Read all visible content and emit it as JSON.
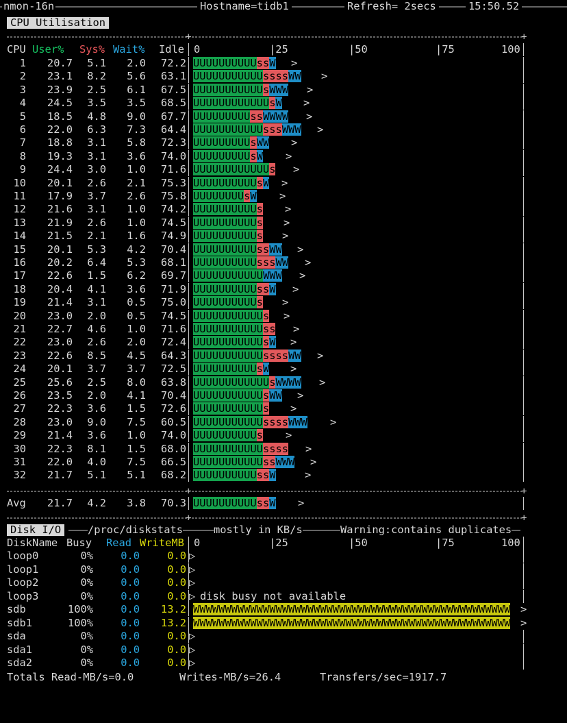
{
  "topbar": {
    "app": "nmon-16n",
    "host": "Hostname=tidb1",
    "refresh": "Refresh= 2secs",
    "time": "15:50.52"
  },
  "cpu": {
    "title": "CPU Utilisation",
    "headers": {
      "cpu": "CPU",
      "user": "User%",
      "sys": "Sys%",
      "wait": "Wait%",
      "idle": "Idle",
      "s0": "0",
      "s25": "|25",
      "s50": "|50",
      "s75": "|75",
      "s100": "100"
    },
    "rows": [
      {
        "cpu": "1",
        "user": "20.7",
        "sys": "5.1",
        "wait": "2.0",
        "idle": "72.2",
        "u": "UUUUUUUUUU",
        "s": "ss",
        "w": "W"
      },
      {
        "cpu": "2",
        "user": "23.1",
        "sys": "8.2",
        "wait": "5.6",
        "idle": "63.1",
        "u": "UUUUUUUUUUU",
        "s": "ssss",
        "w": "WW"
      },
      {
        "cpu": "3",
        "user": "23.9",
        "sys": "2.5",
        "wait": "6.1",
        "idle": "67.5",
        "u": "UUUUUUUUUUU",
        "s": "s",
        "w": "WWW"
      },
      {
        "cpu": "4",
        "user": "24.5",
        "sys": "3.5",
        "wait": "3.5",
        "idle": "68.5",
        "u": "UUUUUUUUUUUU",
        "s": "s",
        "w": "W"
      },
      {
        "cpu": "5",
        "user": "18.5",
        "sys": "4.8",
        "wait": "9.0",
        "idle": "67.7",
        "u": "UUUUUUUUU",
        "s": "ss",
        "w": "WWWW"
      },
      {
        "cpu": "6",
        "user": "22.0",
        "sys": "6.3",
        "wait": "7.3",
        "idle": "64.4",
        "u": "UUUUUUUUUUU",
        "s": "sss",
        "w": "WWW"
      },
      {
        "cpu": "7",
        "user": "18.8",
        "sys": "3.1",
        "wait": "5.8",
        "idle": "72.3",
        "u": "UUUUUUUUU",
        "s": "s",
        "w": "WW"
      },
      {
        "cpu": "8",
        "user": "19.3",
        "sys": "3.1",
        "wait": "3.6",
        "idle": "74.0",
        "u": "UUUUUUUUU",
        "s": "s",
        "w": "W"
      },
      {
        "cpu": "9",
        "user": "24.4",
        "sys": "3.0",
        "wait": "1.0",
        "idle": "71.6",
        "u": "UUUUUUUUUUUU",
        "s": "s",
        "w": ""
      },
      {
        "cpu": "10",
        "user": "20.1",
        "sys": "2.6",
        "wait": "2.1",
        "idle": "75.3",
        "u": "UUUUUUUUUU",
        "s": "s",
        "w": "W"
      },
      {
        "cpu": "11",
        "user": "17.9",
        "sys": "3.7",
        "wait": "2.6",
        "idle": "75.8",
        "u": "UUUUUUUU",
        "s": "s",
        "w": "W"
      },
      {
        "cpu": "12",
        "user": "21.6",
        "sys": "3.1",
        "wait": "1.0",
        "idle": "74.2",
        "u": "UUUUUUUUUU",
        "s": "s",
        "w": ""
      },
      {
        "cpu": "13",
        "user": "21.9",
        "sys": "2.6",
        "wait": "1.0",
        "idle": "74.5",
        "u": "UUUUUUUUUU",
        "s": "s",
        "w": ""
      },
      {
        "cpu": "14",
        "user": "21.5",
        "sys": "2.1",
        "wait": "1.6",
        "idle": "74.9",
        "u": "UUUUUUUUUU",
        "s": "s",
        "w": ""
      },
      {
        "cpu": "15",
        "user": "20.1",
        "sys": "5.3",
        "wait": "4.2",
        "idle": "70.4",
        "u": "UUUUUUUUUU",
        "s": "ss",
        "w": "WW"
      },
      {
        "cpu": "16",
        "user": "20.2",
        "sys": "6.4",
        "wait": "5.3",
        "idle": "68.1",
        "u": "UUUUUUUUUU",
        "s": "sss",
        "w": "WW"
      },
      {
        "cpu": "17",
        "user": "22.6",
        "sys": "1.5",
        "wait": "6.2",
        "idle": "69.7",
        "u": "UUUUUUUUUUU",
        "s": "",
        "w": "WWW"
      },
      {
        "cpu": "18",
        "user": "20.4",
        "sys": "4.1",
        "wait": "3.6",
        "idle": "71.9",
        "u": "UUUUUUUUUU",
        "s": "ss",
        "w": "W"
      },
      {
        "cpu": "19",
        "user": "21.4",
        "sys": "3.1",
        "wait": "0.5",
        "idle": "75.0",
        "u": "UUUUUUUUUU",
        "s": "s",
        "w": ""
      },
      {
        "cpu": "20",
        "user": "23.0",
        "sys": "2.0",
        "wait": "0.5",
        "idle": "74.5",
        "u": "UUUUUUUUUUU",
        "s": "s",
        "w": ""
      },
      {
        "cpu": "21",
        "user": "22.7",
        "sys": "4.6",
        "wait": "1.0",
        "idle": "71.6",
        "u": "UUUUUUUUUUU",
        "s": "ss",
        "w": ""
      },
      {
        "cpu": "22",
        "user": "23.0",
        "sys": "2.6",
        "wait": "2.0",
        "idle": "72.4",
        "u": "UUUUUUUUUUU",
        "s": "s",
        "w": "W"
      },
      {
        "cpu": "23",
        "user": "22.6",
        "sys": "8.5",
        "wait": "4.5",
        "idle": "64.3",
        "u": "UUUUUUUUUUU",
        "s": "ssss",
        "w": "WW"
      },
      {
        "cpu": "24",
        "user": "20.1",
        "sys": "3.7",
        "wait": "3.7",
        "idle": "72.5",
        "u": "UUUUUUUUUU",
        "s": "s",
        "w": "W"
      },
      {
        "cpu": "25",
        "user": "25.6",
        "sys": "2.5",
        "wait": "8.0",
        "idle": "63.8",
        "u": "UUUUUUUUUUUU",
        "s": "s",
        "w": "WWWW"
      },
      {
        "cpu": "26",
        "user": "23.5",
        "sys": "2.0",
        "wait": "4.1",
        "idle": "70.4",
        "u": "UUUUUUUUUUU",
        "s": "s",
        "w": "WW"
      },
      {
        "cpu": "27",
        "user": "22.3",
        "sys": "3.6",
        "wait": "1.5",
        "idle": "72.6",
        "u": "UUUUUUUUUUU",
        "s": "s",
        "w": ""
      },
      {
        "cpu": "28",
        "user": "23.0",
        "sys": "9.0",
        "wait": "7.5",
        "idle": "60.5",
        "u": "UUUUUUUUUUU",
        "s": "ssss",
        "w": "WWW"
      },
      {
        "cpu": "29",
        "user": "21.4",
        "sys": "3.6",
        "wait": "1.0",
        "idle": "74.0",
        "u": "UUUUUUUUUU",
        "s": "s",
        "w": ""
      },
      {
        "cpu": "30",
        "user": "22.3",
        "sys": "8.1",
        "wait": "1.5",
        "idle": "68.0",
        "u": "UUUUUUUUUUU",
        "s": "ssss",
        "w": ""
      },
      {
        "cpu": "31",
        "user": "22.0",
        "sys": "4.0",
        "wait": "7.5",
        "idle": "66.5",
        "u": "UUUUUUUUUUU",
        "s": "ss",
        "w": "WWW"
      },
      {
        "cpu": "32",
        "user": "21.7",
        "sys": "5.1",
        "wait": "5.1",
        "idle": "68.2",
        "u": "UUUUUUUUUU",
        "s": "ss",
        "w": "W"
      }
    ],
    "avg": {
      "label": "Avg",
      "user": "21.7",
      "sys": "4.2",
      "wait": "3.8",
      "idle": "70.3",
      "u": "UUUUUUUUUU",
      "s": "ss",
      "w": "W"
    }
  },
  "disk": {
    "title": "Disk I/O",
    "source": "/proc/diskstats",
    "units": "mostly in KB/s",
    "warning": "Warning:contains duplicates",
    "headers": {
      "name": "DiskName",
      "busy": "Busy",
      "read": "Read",
      "write": "WriteMB",
      "s0": "0",
      "s25": "|25",
      "s50": "|50",
      "s75": "|75",
      "s100": "100"
    },
    "rows": [
      {
        "name": "loop0",
        "busy": "0%",
        "read": "0.0",
        "write": "0.0",
        "bar": "",
        "note": ""
      },
      {
        "name": "loop1",
        "busy": "0%",
        "read": "0.0",
        "write": "0.0",
        "bar": "",
        "note": ""
      },
      {
        "name": "loop2",
        "busy": "0%",
        "read": "0.0",
        "write": "0.0",
        "bar": "",
        "note": ""
      },
      {
        "name": "loop3",
        "busy": "0%",
        "read": "0.0",
        "write": "0.0",
        "bar": "",
        "note": "disk busy not available"
      },
      {
        "name": "sdb",
        "busy": "100%",
        "read": "0.0",
        "write": "13.2",
        "bar": "WWWWWWWWWWWWWWWWWWWWWWWWWWWWWWWWWWWWWWWWWWWWWWWWWW",
        "note": ""
      },
      {
        "name": "sdb1",
        "busy": "100%",
        "read": "0.0",
        "write": "13.2",
        "bar": "WWWWWWWWWWWWWWWWWWWWWWWWWWWWWWWWWWWWWWWWWWWWWWWWWW",
        "note": ""
      },
      {
        "name": "sda",
        "busy": "0%",
        "read": "0.0",
        "write": "0.0",
        "bar": "",
        "note": ""
      },
      {
        "name": "sda1",
        "busy": "0%",
        "read": "0.0",
        "write": "0.0",
        "bar": "",
        "note": ""
      },
      {
        "name": "sda2",
        "busy": "0%",
        "read": "0.0",
        "write": "0.0",
        "bar": "",
        "note": ""
      }
    ],
    "totals": {
      "read": "Totals Read-MB/s=0.0",
      "writes": "Writes-MB/s=26.4",
      "transfers": "Transfers/sec=1917.7"
    }
  },
  "colors": {
    "user": "#16c060",
    "sys": "#e8565a",
    "wait": "#2aa7e0",
    "write": "#d8d80a"
  }
}
